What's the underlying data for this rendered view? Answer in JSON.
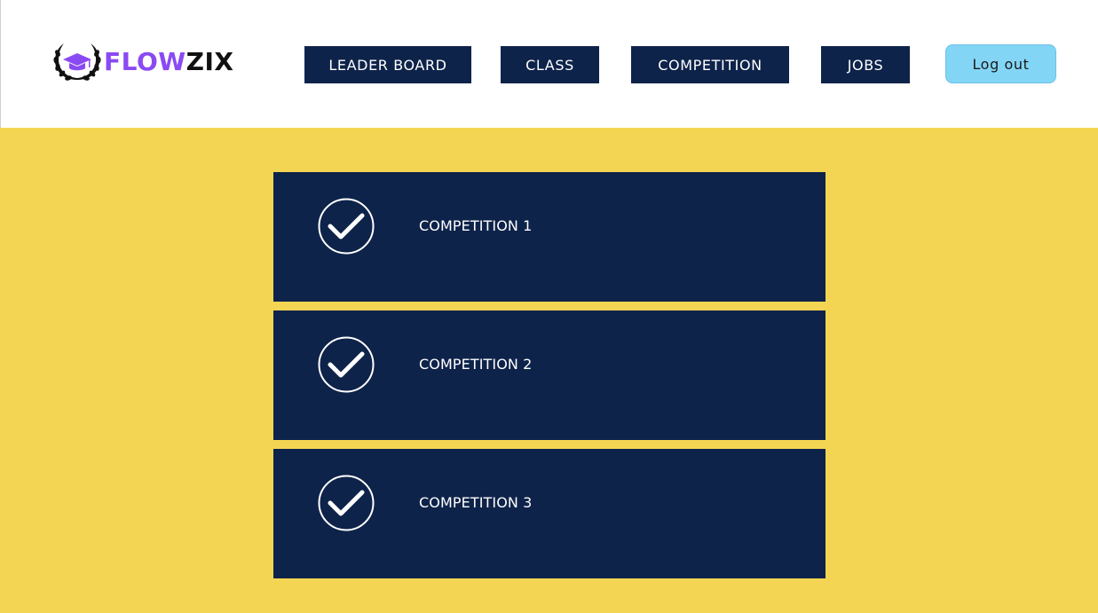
{
  "brand": {
    "name_part1": "FLOW",
    "name_part2": "ZIX",
    "emblem_icon": "graduation-cap-laurel-icon",
    "colors": {
      "accent": "#8a4af3",
      "dark": "#111111"
    }
  },
  "nav": {
    "items": [
      {
        "label": "LEADER BOARD"
      },
      {
        "label": "CLASS"
      },
      {
        "label": "COMPETITION"
      },
      {
        "label": "JOBS"
      }
    ],
    "logout_label": "Log out"
  },
  "competitions": [
    {
      "title": "COMPETITION 1",
      "icon": "check-circle-icon"
    },
    {
      "title": "COMPETITION 2",
      "icon": "check-circle-icon"
    },
    {
      "title": "COMPETITION 3",
      "icon": "check-circle-icon"
    }
  ],
  "colors": {
    "navy": "#0e234a",
    "page_background": "#f4d553",
    "logout_button": "#83d5f5",
    "header_background": "#ffffff"
  }
}
